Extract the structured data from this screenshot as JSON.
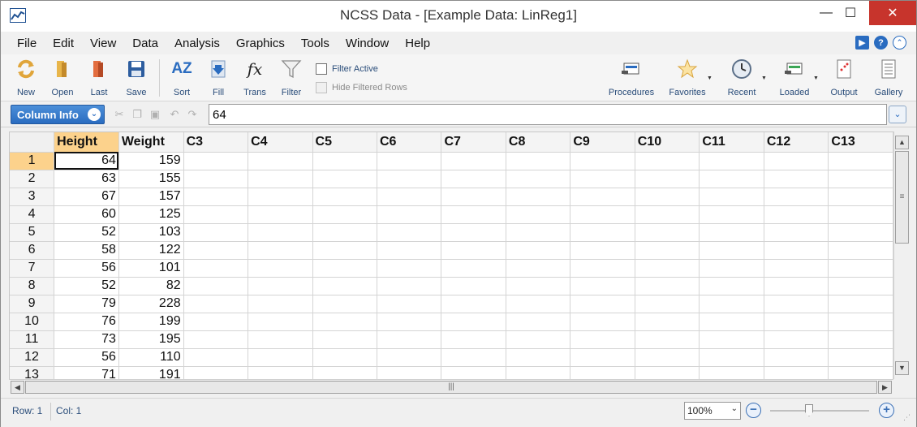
{
  "window": {
    "title": "NCSS Data - [Example Data: LinReg1]",
    "minimize_glyph": "—",
    "maximize_glyph": "☐",
    "close_glyph": "✕"
  },
  "menu": [
    "File",
    "Edit",
    "View",
    "Data",
    "Analysis",
    "Graphics",
    "Tools",
    "Window",
    "Help"
  ],
  "toolbar": {
    "new": "New",
    "open": "Open",
    "last": "Last",
    "save": "Save",
    "sort": "Sort",
    "fill": "Fill",
    "trans": "Trans",
    "filter": "Filter",
    "filter_active": "Filter Active",
    "hide_filtered_rows": "Hide Filtered Rows",
    "procedures": "Procedures",
    "favorites": "Favorites",
    "recent": "Recent",
    "loaded": "Loaded",
    "output": "Output",
    "gallery": "Gallery",
    "sort_glyph": "AZ",
    "trans_glyph": "fx"
  },
  "infobar": {
    "column_info": "Column Info",
    "cell_value": "64"
  },
  "grid": {
    "columns": [
      "Height",
      "Weight",
      "C3",
      "C4",
      "C5",
      "C6",
      "C7",
      "C8",
      "C9",
      "C10",
      "C11",
      "C12",
      "C13"
    ],
    "rows": [
      {
        "n": "1",
        "height": "64",
        "weight": "159"
      },
      {
        "n": "2",
        "height": "63",
        "weight": "155"
      },
      {
        "n": "3",
        "height": "67",
        "weight": "157"
      },
      {
        "n": "4",
        "height": "60",
        "weight": "125"
      },
      {
        "n": "5",
        "height": "52",
        "weight": "103"
      },
      {
        "n": "6",
        "height": "58",
        "weight": "122"
      },
      {
        "n": "7",
        "height": "56",
        "weight": "101"
      },
      {
        "n": "8",
        "height": "52",
        "weight": "82"
      },
      {
        "n": "9",
        "height": "79",
        "weight": "228"
      },
      {
        "n": "10",
        "height": "76",
        "weight": "199"
      },
      {
        "n": "11",
        "height": "73",
        "weight": "195"
      },
      {
        "n": "12",
        "height": "56",
        "weight": "110"
      },
      {
        "n": "13",
        "height": "71",
        "weight": "191"
      }
    ]
  },
  "status": {
    "row": "Row: 1",
    "col": "Col: 1",
    "zoom": "100%",
    "zoom_level": 1.0
  },
  "colors": {
    "active_header": "#fcd28c",
    "accent_blue": "#2a6cc0",
    "close_red": "#c7342c"
  }
}
